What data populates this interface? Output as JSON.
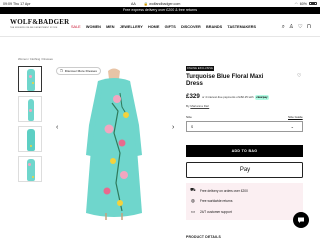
{
  "status": {
    "time": "09:09",
    "date": "Thu 17 Apr",
    "text_size": "AA",
    "url": "wolfandbadger.com",
    "battery": "60%"
  },
  "promo": "Free express delivery over £200 & free returns",
  "brand": {
    "name": "WOLF&BADGER",
    "tagline": "THE MODERN ONLINE DEPARTMENT STORE"
  },
  "menu": [
    "SALE",
    "WOMEN",
    "MEN",
    "JEWELLERY",
    "HOME",
    "GIFTS",
    "DISCOVER",
    "BRANDS",
    "TASTEMAKERS"
  ],
  "breadcrumb": "Women / Clothing / Dresses",
  "discover_label": "Discover More Dresses",
  "product": {
    "badge": "ONLINE EXCLUSIVE",
    "title": "Turquoise Blue Floral Maxi Dress",
    "price": "£329",
    "klarna_text": "or 4 interest-free payments of £82.25 with",
    "klarna_brand": "clearpay",
    "by_prefix": "By",
    "designer": "Marianna Déri",
    "size_label": "Size",
    "size_guide": "Size Guide",
    "size_value": "S",
    "add_to_bag": "ADD TO BAG",
    "apple_pay": "Pay",
    "details": "PRODUCT DETAILS"
  },
  "benefits": [
    {
      "icon": "truck-icon",
      "label": "Free delivery on orders over £200"
    },
    {
      "icon": "globe-icon",
      "label": "Free worldwide returns"
    },
    {
      "icon": "chat-icon",
      "label": "24/7 customer support"
    }
  ],
  "colors": {
    "accent_sale": "#c8102e",
    "dress": "#6fd6cc",
    "benefits_bg": "#fbeff2",
    "clearpay": "#b2fce4"
  }
}
